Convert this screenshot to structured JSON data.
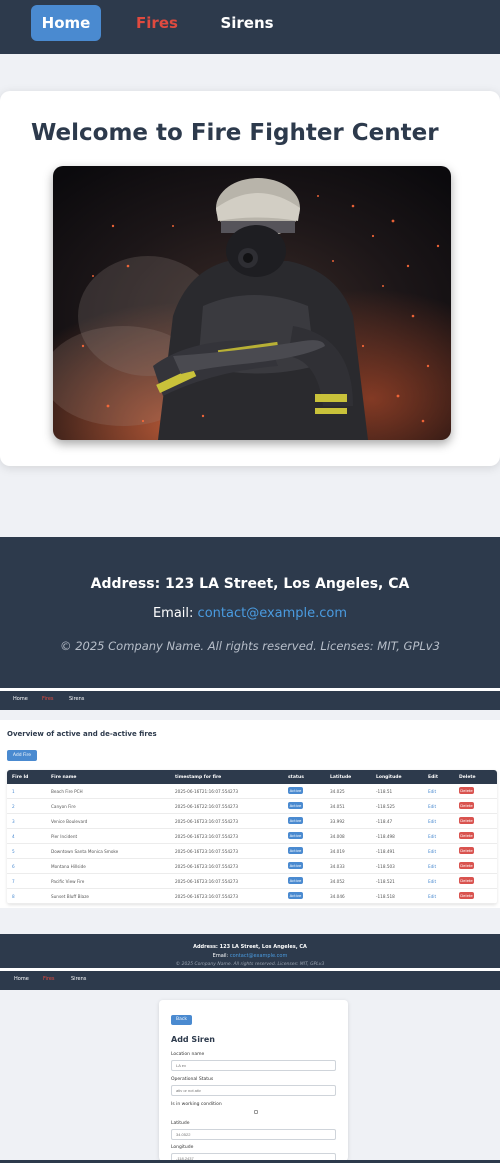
{
  "nav": {
    "home": "Home",
    "fires": "Fires",
    "sirens": "Sirens"
  },
  "home": {
    "welcome": "Welcome to Fire Fighter Center"
  },
  "footer": {
    "address": "Address: 123 LA Street, Los Angeles, CA",
    "email_label": "Email:",
    "email": "contact@example.com",
    "copyright": "© 2025 Company Name. All rights reserved. Licenses: MIT, GPLv3"
  },
  "fires": {
    "title": "Overview of active and de-active fires",
    "add_button": "Add Fire",
    "columns": [
      "Fire Id",
      "Fire name",
      "timestamp for fire",
      "status",
      "Latitude",
      "Longitude",
      "Edit",
      "Delete"
    ],
    "rows": [
      {
        "id": "1",
        "name": "Beach Fire PCH",
        "timestamp": "2025-06-16T21:16:07.554273",
        "status": "Active",
        "lat": "34.025",
        "lon": "-118.51",
        "edit": "Edit",
        "delete": "Delete"
      },
      {
        "id": "2",
        "name": "Canyon Fire",
        "timestamp": "2025-06-16T22:16:07.554273",
        "status": "Active",
        "lat": "34.051",
        "lon": "-118.525",
        "edit": "Edit",
        "delete": "Delete"
      },
      {
        "id": "3",
        "name": "Venice Boulevard",
        "timestamp": "2025-06-16T23:16:07.554273",
        "status": "Active",
        "lat": "33.992",
        "lon": "-118.47",
        "edit": "Edit",
        "delete": "Delete"
      },
      {
        "id": "4",
        "name": "Pier Incident",
        "timestamp": "2025-06-16T23:16:07.554273",
        "status": "Active",
        "lat": "34.008",
        "lon": "-118.498",
        "edit": "Edit",
        "delete": "Delete"
      },
      {
        "id": "5",
        "name": "Downtown Santa Monica Smoke",
        "timestamp": "2025-06-16T23:16:07.554273",
        "status": "Active",
        "lat": "34.019",
        "lon": "-118.491",
        "edit": "Edit",
        "delete": "Delete"
      },
      {
        "id": "6",
        "name": "Montana Hillside",
        "timestamp": "2025-06-16T23:16:07.554273",
        "status": "Active",
        "lat": "34.033",
        "lon": "-118.503",
        "edit": "Edit",
        "delete": "Delete"
      },
      {
        "id": "7",
        "name": "Pacific View Fire",
        "timestamp": "2025-06-16T23:16:07.554273",
        "status": "Active",
        "lat": "34.052",
        "lon": "-118.521",
        "edit": "Edit",
        "delete": "Delete"
      },
      {
        "id": "8",
        "name": "Sunset Bluff Blaze",
        "timestamp": "2025-06-16T23:16:07.554273",
        "status": "Active",
        "lat": "34.046",
        "lon": "-118.518",
        "edit": "Edit",
        "delete": "Delete"
      }
    ]
  },
  "siren_form": {
    "back": "Back",
    "title": "Add Siren",
    "location_label": "Location name",
    "location_placeholder": "LA ex",
    "status_label": "Operational Status",
    "status_placeholder": "ativ or not ativ",
    "working_label": "Is in working condition",
    "lat_label": "Latitude",
    "lat_placeholder": "34.0522",
    "lon_label": "Longitude",
    "lon_placeholder": "-118.2437"
  },
  "colors": {
    "navy": "#2d3a4c",
    "accent": "#4a8ad0",
    "fires_red": "#e04a3f",
    "delete_red": "#d9534f"
  }
}
